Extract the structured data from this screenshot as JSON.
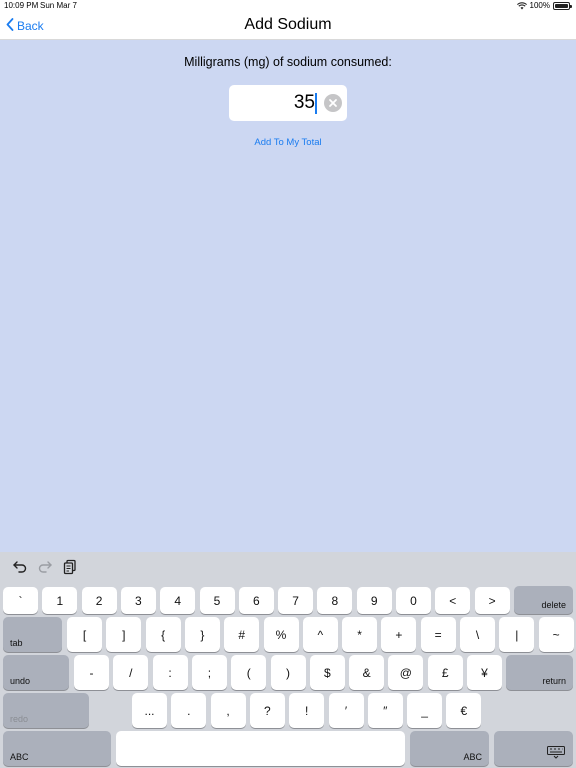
{
  "status_bar": {
    "time": "10:09 PM",
    "date": "Sun Mar 7",
    "battery": "100%"
  },
  "nav": {
    "back_label": "Back",
    "title": "Add Sodium"
  },
  "form": {
    "prompt": "Milligrams (mg) of sodium consumed:",
    "value": "35",
    "add_label": "Add To My Total"
  },
  "keyboard": {
    "toolbar": [
      "undo-arrow-icon",
      "redo-arrow-icon",
      "clipboard-icon"
    ],
    "row1": [
      "`",
      "1",
      "2",
      "3",
      "4",
      "5",
      "6",
      "7",
      "8",
      "9",
      "0",
      "<",
      ">"
    ],
    "row1_action": "delete",
    "row2_action": "tab",
    "row2": [
      "[",
      "]",
      "{",
      "}",
      "#",
      "%",
      "^",
      "*",
      "+",
      "=",
      "\\",
      "|",
      "~"
    ],
    "row3_action": "undo",
    "row3": [
      "-",
      "/",
      ":",
      ";",
      "(",
      ")",
      "$",
      "&",
      "@",
      "£",
      "¥"
    ],
    "row3_return": "return",
    "row4_action": "redo",
    "row4": [
      "...",
      ".",
      ",",
      "?",
      "!",
      "′",
      "″",
      "_",
      "€"
    ],
    "row5_left": "ABC",
    "row5_right": "ABC"
  },
  "colors": {
    "background": "#ccd7f2",
    "accent": "#1a7cf0",
    "keyboard": "#d2d5db"
  }
}
